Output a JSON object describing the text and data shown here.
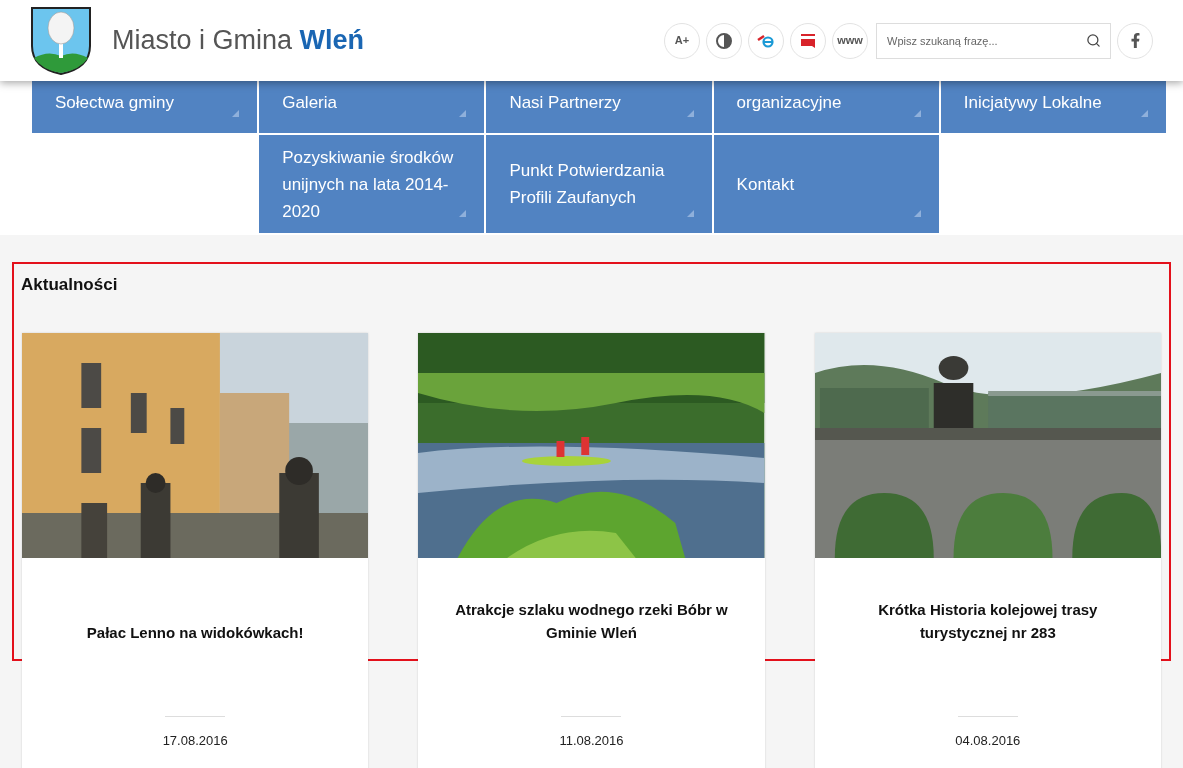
{
  "header": {
    "site_name": "Miasto i Gmina ",
    "site_name_bold": "Wleń",
    "tools": [
      {
        "kind": "text",
        "label": "A+"
      },
      {
        "kind": "contrast"
      },
      {
        "kind": "epuap"
      },
      {
        "kind": "bip"
      },
      {
        "kind": "text",
        "label": "www"
      }
    ],
    "search": {
      "placeholder": "Wpisz szukaną frazę..."
    }
  },
  "menu": {
    "rows": [
      [
        {
          "label": "Sołectwa gminy"
        },
        {
          "label": "Galeria"
        },
        {
          "label": "Nasi Partnerzy"
        },
        {
          "label": "organizacyjne"
        },
        {
          "label": "Inicjatywy Lokalne"
        }
      ],
      [
        null,
        {
          "label": "Pozyskiwanie środków unijnych na lata 2014-2020"
        },
        {
          "label": "Punkt Potwierdzania Profili Zaufanych"
        },
        {
          "label": "Kontakt"
        },
        null
      ]
    ]
  },
  "news": {
    "title": "Aktualności",
    "items": [
      {
        "title": "Pałac Lenno na widokówkach!",
        "date": "17.08.2016"
      },
      {
        "title": "Atrakcje szlaku wodnego rzeki Bóbr w Gminie Wleń",
        "date": "11.08.2016"
      },
      {
        "title": "Krótka Historia kolejowej trasy turystycznej nr 283",
        "date": "04.08.2016"
      }
    ]
  }
}
